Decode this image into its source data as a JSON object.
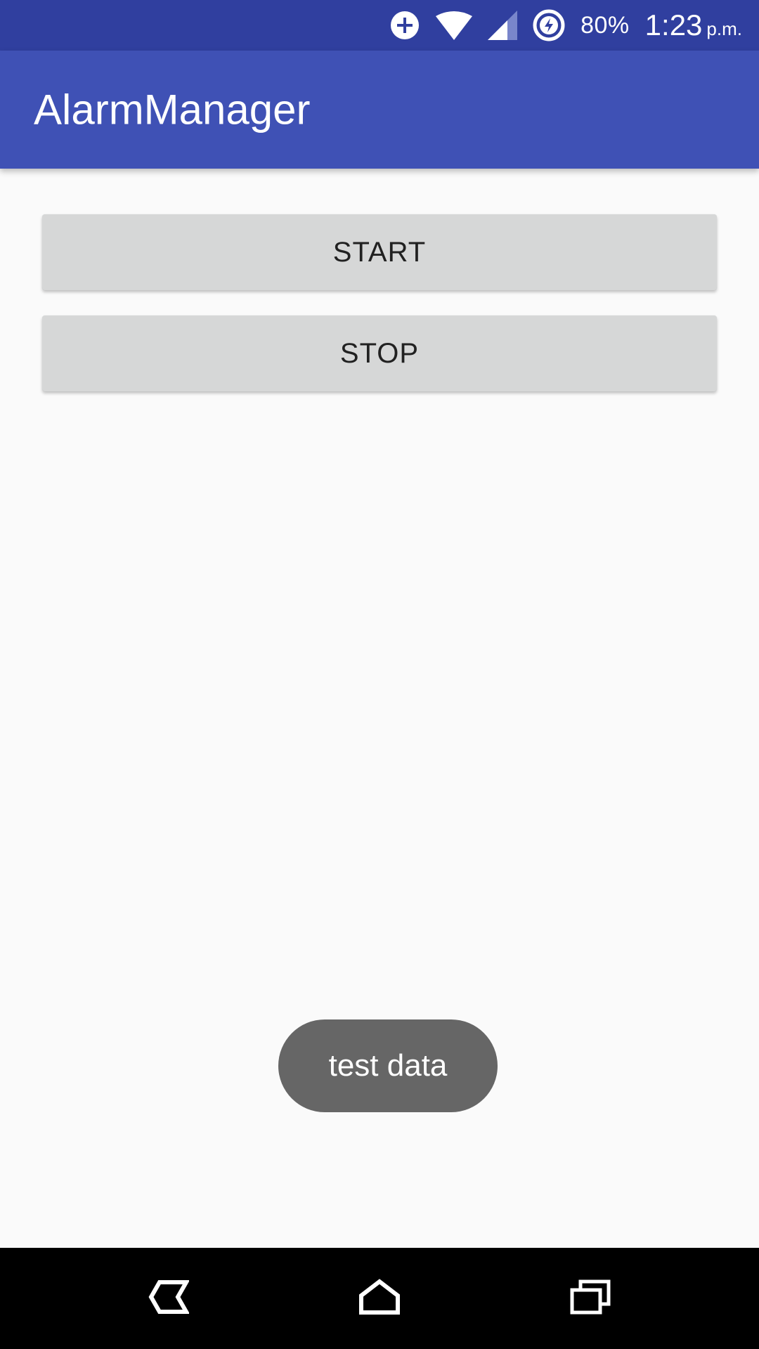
{
  "status_bar": {
    "icons": [
      "data-saver-icon",
      "wifi-icon",
      "cell-signal-icon",
      "battery-charging-icon"
    ],
    "battery_percent": "80%",
    "time": "1:23",
    "time_suffix": "p.m."
  },
  "app_bar": {
    "title": "AlarmManager"
  },
  "main": {
    "start_label": "START",
    "stop_label": "STOP"
  },
  "toast": {
    "message": "test data"
  },
  "nav_bar": {
    "icons": [
      "back-icon",
      "home-icon",
      "recents-icon"
    ]
  },
  "colors": {
    "status_bar": "#303f9f",
    "app_bar": "#3f51b5",
    "background": "#fafafa",
    "button": "#d6d7d7",
    "toast": "#666666",
    "nav_bar": "#000000"
  }
}
